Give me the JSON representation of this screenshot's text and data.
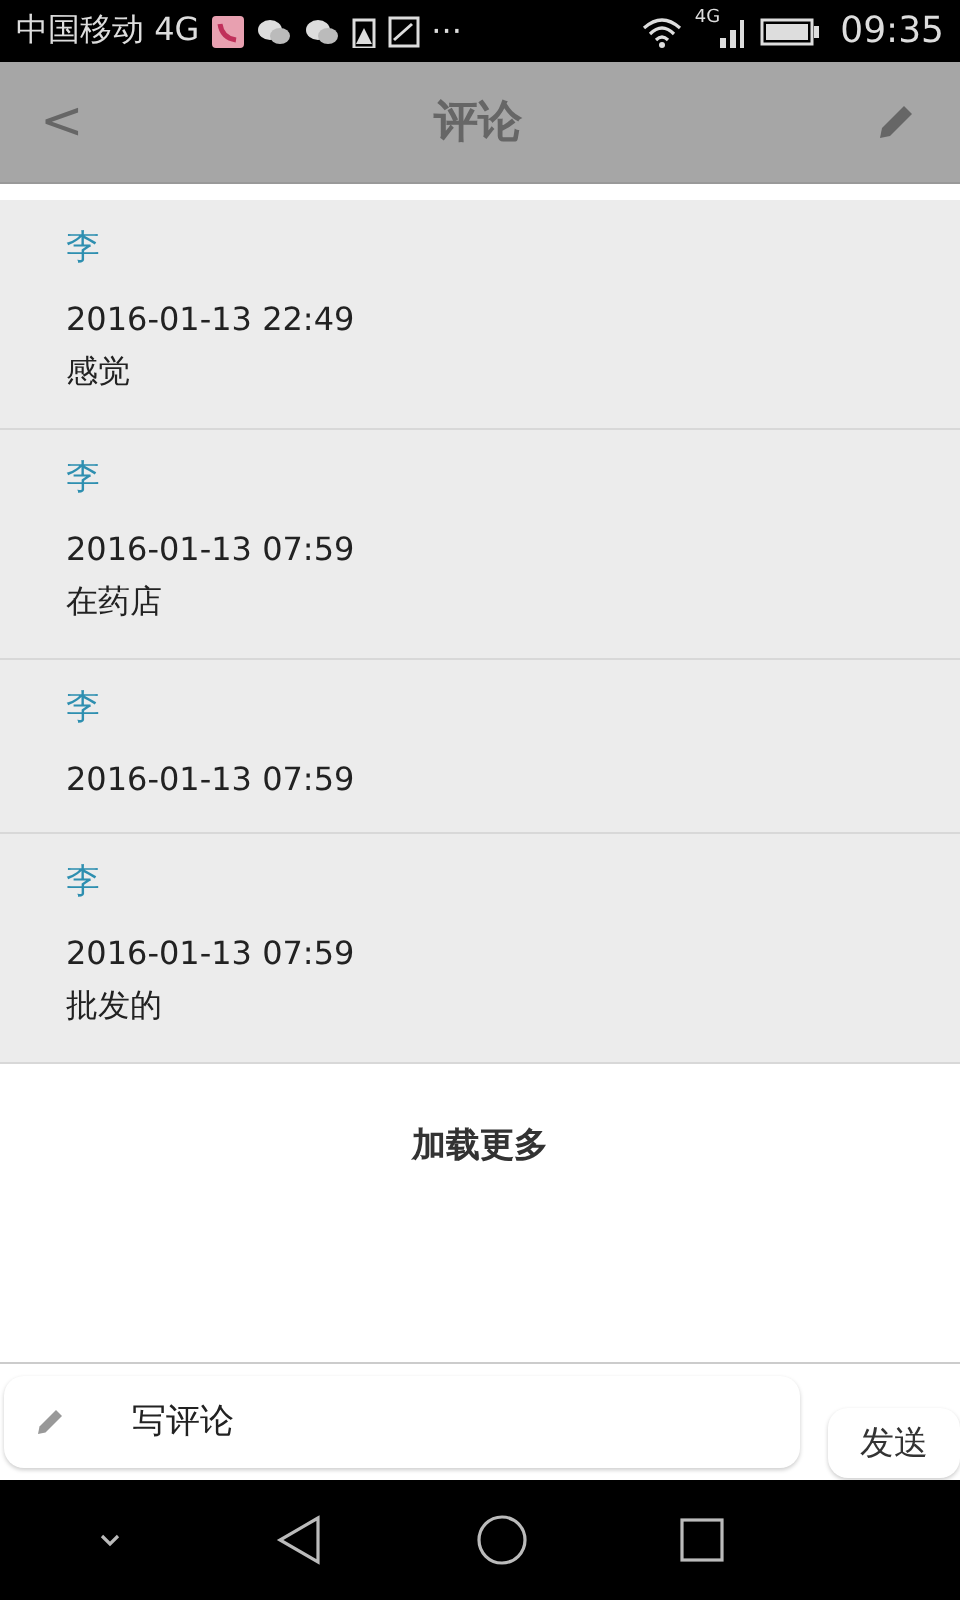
{
  "status_bar": {
    "carrier": "中国移动 4G",
    "more": "···",
    "network": "4G",
    "time": "09:35"
  },
  "app_bar": {
    "back": "<",
    "title": "评论"
  },
  "comments": [
    {
      "author": "李",
      "time": "2016-01-13 22:49",
      "text": "感觉"
    },
    {
      "author": "李",
      "time": "2016-01-13 07:59",
      "text": "在药店"
    },
    {
      "author": "李",
      "time": "2016-01-13 07:59"
    },
    {
      "author": "李",
      "time": "2016-01-13 07:59",
      "text": "批发的"
    }
  ],
  "load_more": "加载更多",
  "composer": {
    "placeholder": "写评论",
    "send": "发送"
  }
}
